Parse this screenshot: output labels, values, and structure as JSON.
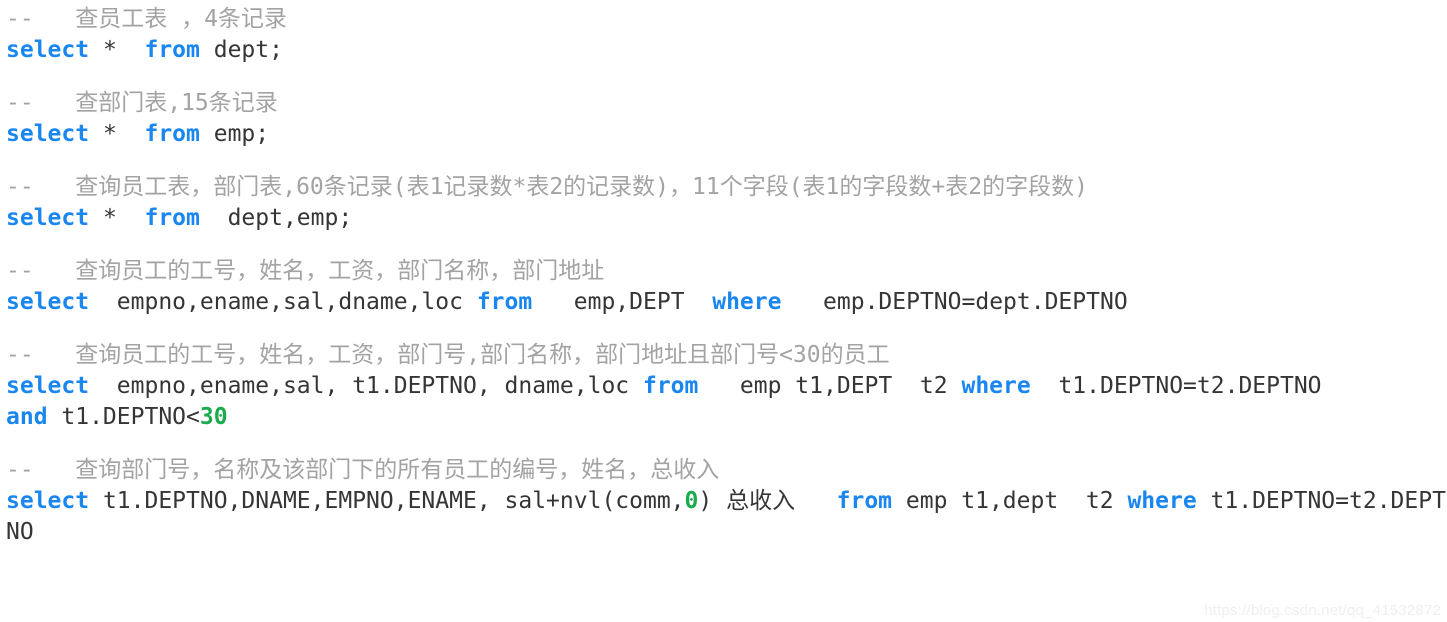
{
  "editor": {
    "language": "sql",
    "background_color": "#ffffff",
    "colors": {
      "keyword": "#1a86f0",
      "comment": "#a3a3a3",
      "text": "#353535",
      "number": "#1cab4c",
      "watermark": "#efefef"
    }
  },
  "statements": [
    {
      "comment": "--   查员工表 ，4条记录",
      "lines": [
        [
          {
            "t": "select",
            "k": "kw"
          },
          {
            "t": " *  ",
            "k": "plain"
          },
          {
            "t": "from",
            "k": "kw"
          },
          {
            "t": " dept;",
            "k": "plain"
          }
        ]
      ]
    },
    {
      "comment": "--   查部门表,15条记录",
      "lines": [
        [
          {
            "t": "select",
            "k": "kw"
          },
          {
            "t": " *  ",
            "k": "plain"
          },
          {
            "t": "from",
            "k": "kw"
          },
          {
            "t": " emp;",
            "k": "plain"
          }
        ]
      ]
    },
    {
      "comment": "--   查询员工表，部门表,60条记录(表1记录数*表2的记录数)，11个字段(表1的字段数+表2的字段数)",
      "lines": [
        [
          {
            "t": "select",
            "k": "kw"
          },
          {
            "t": " *  ",
            "k": "plain"
          },
          {
            "t": "from",
            "k": "kw"
          },
          {
            "t": "  dept,emp;",
            "k": "plain"
          }
        ]
      ]
    },
    {
      "comment": "--   查询员工的工号，姓名，工资，部门名称，部门地址",
      "lines": [
        [
          {
            "t": "select",
            "k": "kw"
          },
          {
            "t": "  empno,ename,sal,dname,loc ",
            "k": "plain"
          },
          {
            "t": "from",
            "k": "kw"
          },
          {
            "t": "   emp,DEPT  ",
            "k": "plain"
          },
          {
            "t": "where",
            "k": "kw"
          },
          {
            "t": "   emp.DEPTNO=dept.DEPTNO",
            "k": "plain"
          }
        ]
      ]
    },
    {
      "comment": "--   查询员工的工号，姓名，工资，部门号,部门名称，部门地址且部门号<30的员工",
      "lines": [
        [
          {
            "t": "select",
            "k": "kw"
          },
          {
            "t": "  empno,ename,sal, t1.DEPTNO, dname,loc ",
            "k": "plain"
          },
          {
            "t": "from",
            "k": "kw"
          },
          {
            "t": "   emp t1,DEPT  t2 ",
            "k": "plain"
          },
          {
            "t": "where",
            "k": "kw"
          },
          {
            "t": "  t1.DEPTNO=t2.DEPTNO",
            "k": "plain"
          }
        ],
        [
          {
            "t": "and",
            "k": "kw"
          },
          {
            "t": " t1.DEPTNO<",
            "k": "plain"
          },
          {
            "t": "30",
            "k": "num"
          }
        ]
      ]
    },
    {
      "comment": "--   查询部门号，名称及该部门下的所有员工的编号，姓名，总收入",
      "lines": [
        [
          {
            "t": "select",
            "k": "kw"
          },
          {
            "t": " t1.DEPTNO,DNAME,EMPNO,ENAME, sal+nvl(comm,",
            "k": "plain"
          },
          {
            "t": "0",
            "k": "num"
          },
          {
            "t": ") 总收入   ",
            "k": "plain"
          },
          {
            "t": "from",
            "k": "kw"
          },
          {
            "t": " emp t1,dept  t2 ",
            "k": "plain"
          },
          {
            "t": "where",
            "k": "kw"
          },
          {
            "t": " t1.DEPTNO=t2.DEPTNO",
            "k": "plain"
          }
        ]
      ]
    }
  ],
  "watermark": "https://blog.csdn.net/qq_41532872"
}
